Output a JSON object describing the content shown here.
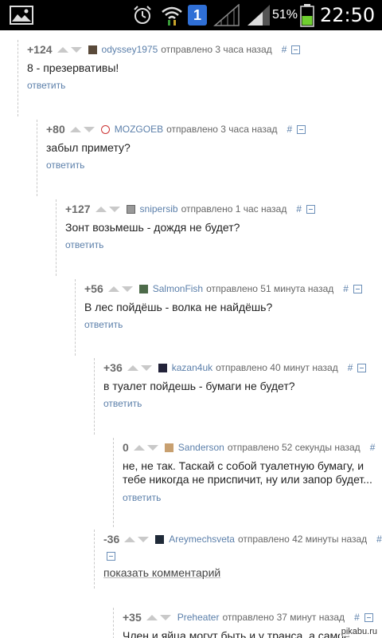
{
  "status_bar": {
    "sim_badge": "1",
    "battery_percent": "51%",
    "time": "22:50"
  },
  "comments": [
    {
      "score": "+124",
      "author": "odyssey1975",
      "meta": "отправлено 3 часа назад",
      "hash": "#",
      "text": "8 - презервативы!",
      "reply": "ответить"
    },
    {
      "score": "+80",
      "author": "MOZGOEB",
      "meta": "отправлено 3 часа назад",
      "hash": "#",
      "text": "забыл примету?",
      "reply": "ответить"
    },
    {
      "score": "+127",
      "author": "snipersib",
      "meta": "отправлено 1 час назад",
      "hash": "#",
      "text": "Зонт возьмешь - дождя не будет?",
      "reply": "ответить"
    },
    {
      "score": "+56",
      "author": "SalmonFish",
      "meta": "отправлено 51 минута назад",
      "hash": "#",
      "text": "В лес пойдёшь - волка не найдёшь?",
      "reply": "ответить"
    },
    {
      "score": "+36",
      "author": "kazan4uk",
      "meta": "отправлено 40 минут назад",
      "hash": "#",
      "text": "в туалет пойдешь - бумаги не будет?",
      "reply": "ответить"
    },
    {
      "score": "0",
      "author": "Sanderson",
      "meta": "отправлено 52 секунды назад",
      "hash": "#",
      "text_line1": "не, не так. Таскай с собой туалетную бумагу, и",
      "text_line2": "тебе никогда не приспичит, ну или запор будет...",
      "reply": "ответить"
    },
    {
      "score": "-36",
      "author": "Areymechsveta",
      "meta": "отправлено 42 минуты назад",
      "hash": "#",
      "show_comment": "показать комментарий"
    },
    {
      "score": "+35",
      "author": "Preheater",
      "meta": "отправлено 37 минут назад",
      "hash": "#",
      "text": "Член и яйца могут быть и у транса, а самое"
    }
  ],
  "watermark": "pikabu.ru",
  "colors": {
    "link": "#5b7faa",
    "text": "#222222",
    "score": "#6b6b6b",
    "arrow": "#c9c9c9",
    "statusbar": "#000000"
  }
}
